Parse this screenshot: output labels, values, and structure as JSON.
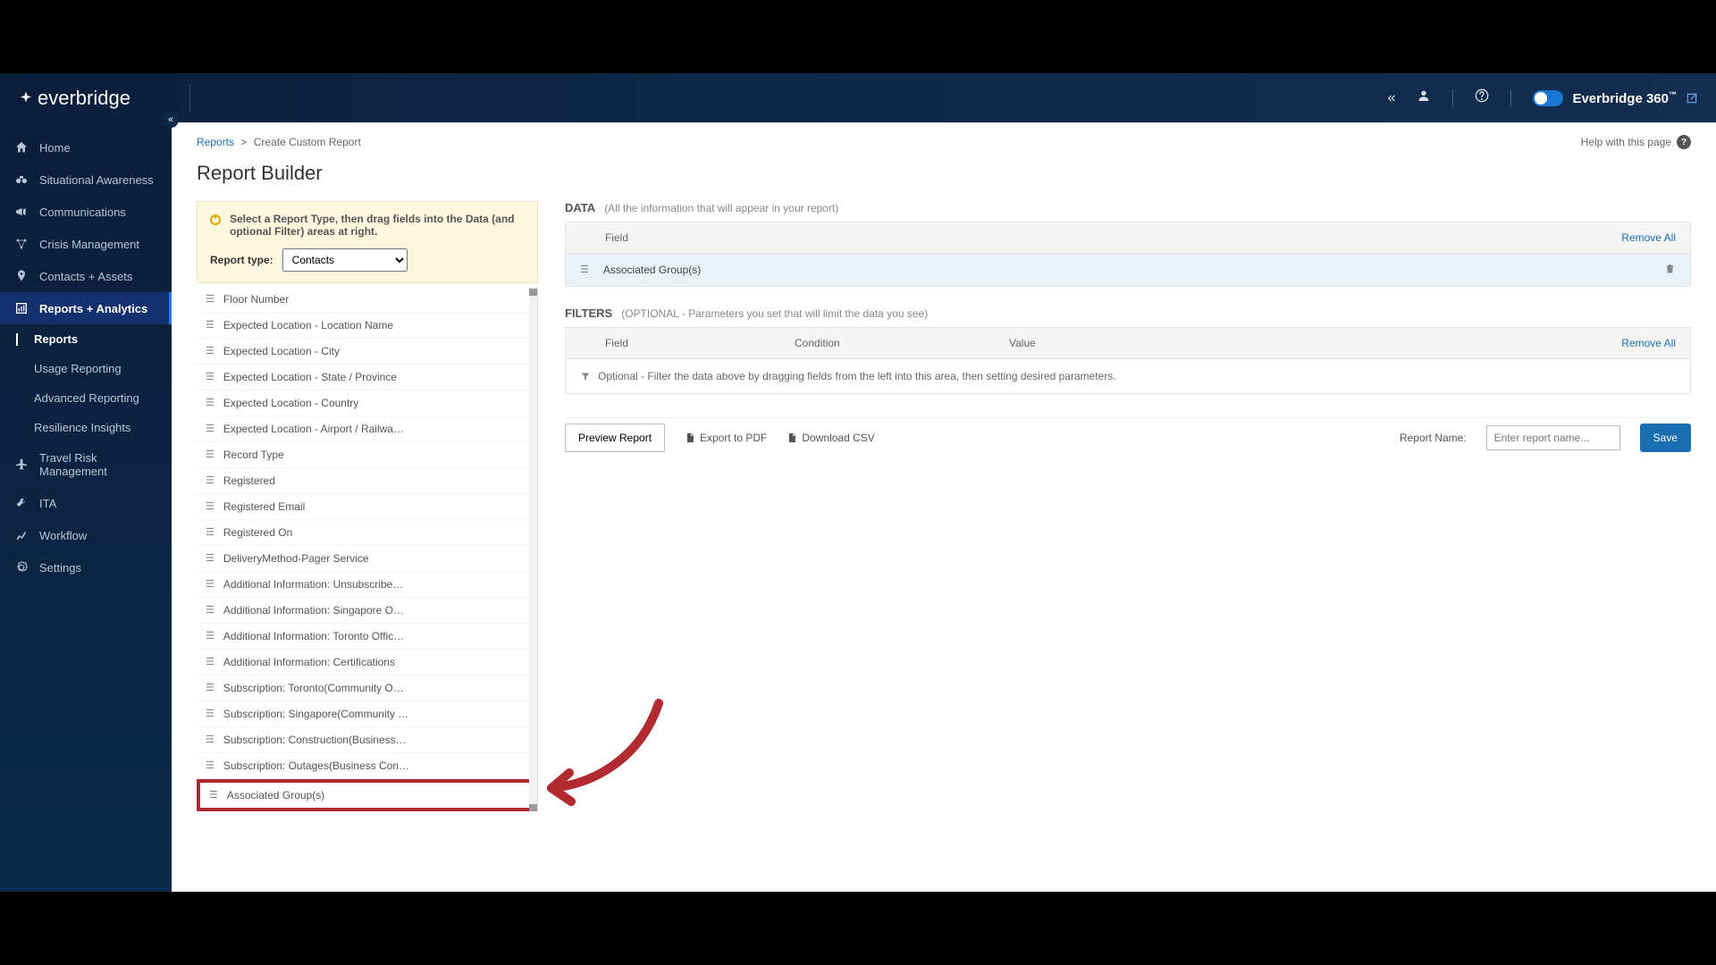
{
  "brand": {
    "name": "everbridge",
    "toggle_label": "Everbridge 360",
    "tm": "™"
  },
  "header_icons": {
    "collapse": "«",
    "user": "user",
    "help": "?"
  },
  "sidebar": {
    "items": [
      {
        "label": "Home",
        "icon": "home"
      },
      {
        "label": "Situational Awareness",
        "icon": "binoculars"
      },
      {
        "label": "Communications",
        "icon": "megaphone"
      },
      {
        "label": "Crisis Management",
        "icon": "network"
      },
      {
        "label": "Contacts + Assets",
        "icon": "pin"
      },
      {
        "label": "Reports + Analytics",
        "icon": "report",
        "active": true
      },
      {
        "label": "Travel Risk Management",
        "icon": "plane"
      },
      {
        "label": "ITA",
        "icon": "wrench"
      },
      {
        "label": "Workflow",
        "icon": "chart"
      },
      {
        "label": "Settings",
        "icon": "gear"
      }
    ],
    "sub_items": [
      {
        "label": "Reports",
        "active": true
      },
      {
        "label": "Usage Reporting"
      },
      {
        "label": "Advanced Reporting"
      },
      {
        "label": "Resilience Insights"
      }
    ],
    "collapse": "«"
  },
  "breadcrumb": {
    "root": "Reports",
    "sep": ">",
    "current": "Create Custom Report",
    "help": "Help with this page"
  },
  "page": {
    "title": "Report Builder"
  },
  "instruction": {
    "text": "Select a Report Type, then drag fields into the Data (and optional Filter) areas at right.",
    "label": "Report type:",
    "selected": "Contacts"
  },
  "fields": [
    "Floor Number",
    "Expected Location - Location Name",
    "Expected Location - City",
    "Expected Location - State / Province",
    "Expected Location - Country",
    "Expected Location - Airport / Railwa…",
    "Record Type",
    "Registered",
    "Registered Email",
    "Registered On",
    "DeliveryMethod-Pager Service",
    "Additional Information: Unsubscribe…",
    "Additional Information: Singapore O…",
    "Additional Information: Toronto Offic…",
    "Additional Information: Certifications",
    "Subscription: Toronto(Community O…",
    "Subscription: Singapore(Community …",
    "Subscription: Construction(Business…",
    "Subscription: Outages(Business Con…",
    "Associated Group(s)"
  ],
  "data_section": {
    "title": "DATA",
    "hint": "(All the information that will appear in your report)",
    "col_field": "Field",
    "remove_all": "Remove All",
    "rows": [
      "Associated Group(s)"
    ]
  },
  "filters_section": {
    "title": "FILTERS",
    "hint": "(OPTIONAL - Parameters you set that will limit the data you see)",
    "col_field": "Field",
    "col_condition": "Condition",
    "col_value": "Value",
    "remove_all": "Remove All",
    "drop_hint": "Optional - Filter the data above by dragging fields from the left into this area, then setting desired parameters."
  },
  "actions": {
    "preview": "Preview Report",
    "export_pdf": "Export to PDF",
    "download_csv": "Download CSV",
    "report_name_label": "Report Name:",
    "report_name_placeholder": "Enter report name...",
    "save": "Save"
  }
}
